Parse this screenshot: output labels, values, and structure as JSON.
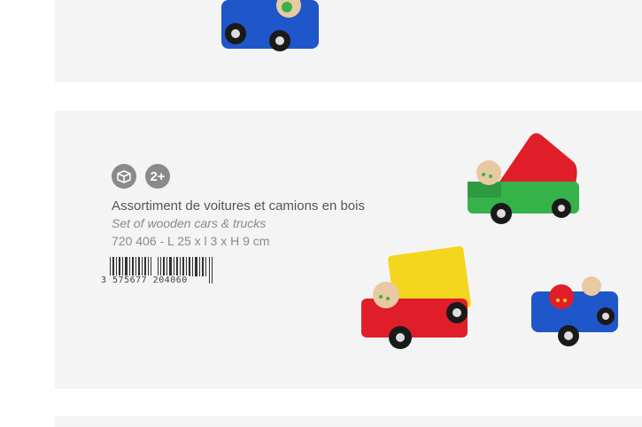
{
  "product": {
    "age_badge": "2+",
    "name_fr": "Assortiment de voitures et camions en bois",
    "name_en": "Set of wooden cars & trucks",
    "reference": "720 406 - L 25 x l 3 x H 9 cm",
    "barcode_number": "3 575677 204060"
  },
  "icons": [
    "box-icon",
    "age-badge-icon"
  ],
  "colors": {
    "card_bg": "#f4f4f5",
    "toy_blue": "#1f56c9",
    "toy_red": "#e01e2a",
    "toy_green": "#36b24a",
    "toy_yellow": "#f5d61e"
  }
}
